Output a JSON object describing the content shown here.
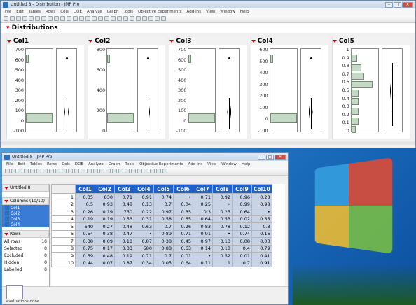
{
  "win1": {
    "title": "Untitled 8 - Distribution - JMP Pro",
    "menu": [
      "File",
      "Edit",
      "Tables",
      "Rows",
      "Cols",
      "DOE",
      "Analyze",
      "Graph",
      "Tools",
      "Objective Experiments",
      "Add-Ins",
      "View",
      "Window",
      "Help"
    ],
    "section_title": "Distributions",
    "panels": [
      {
        "name": "Col1",
        "ticks": [
          "700",
          "600",
          "500",
          "400",
          "300",
          "200",
          "100",
          "0",
          "-100"
        ],
        "bar_frac": 0.12,
        "outlier": true
      },
      {
        "name": "Col2",
        "ticks": [
          "800",
          "600",
          "400",
          "200",
          "0"
        ],
        "bar_frac": 0.1,
        "outlier": true
      },
      {
        "name": "Col3",
        "ticks": [
          "700",
          "600",
          "500",
          "400",
          "300",
          "200",
          "100",
          "0",
          "-100"
        ],
        "bar_frac": 0.12,
        "outlier": true
      },
      {
        "name": "Col4",
        "ticks": [
          "600",
          "500",
          "400",
          "300",
          "200",
          "100",
          "0",
          "-100"
        ],
        "bar_frac": 0.12,
        "outlier": true
      },
      {
        "name": "Col5",
        "ticks": [
          "1",
          "0.9",
          "0.8",
          "0.7",
          "0.6",
          "0.5",
          "0.4",
          "0.3",
          "0.2",
          "0.1",
          "0"
        ],
        "bar_frac": 0,
        "outlier": false
      }
    ]
  },
  "win2": {
    "title": "Untitled 8 - JMP Pro",
    "menu": [
      "File",
      "Edit",
      "Tables",
      "Rows",
      "Cols",
      "DOE",
      "Analyze",
      "Graph",
      "Tools",
      "Objective Experiments",
      "Add-Ins",
      "View",
      "Window",
      "Help"
    ],
    "table_name": "Untitled 8",
    "columns_header": "Columns (10/10)",
    "column_list": [
      "Col1",
      "Col2",
      "Col3",
      "Col4"
    ],
    "rows_header": "Rows",
    "row_summary": [
      {
        "label": "All rows",
        "value": "10"
      },
      {
        "label": "Selected",
        "value": "0"
      },
      {
        "label": "Excluded",
        "value": "0"
      },
      {
        "label": "Hidden",
        "value": "0"
      },
      {
        "label": "Labelled",
        "value": "0"
      }
    ],
    "col_headers": [
      "Col1",
      "Col2",
      "Col3",
      "Col4",
      "Col5",
      "Col6",
      "Col7",
      "Col8",
      "Col9",
      "Col10"
    ],
    "rows": [
      [
        "1",
        "0.35",
        "830",
        "0.71",
        "0.91",
        "0.74",
        "•",
        "0.71",
        "0.92",
        "0.96",
        "0.28"
      ],
      [
        "2",
        "0.5",
        "0.93",
        "0.48",
        "0.13",
        "0.7",
        "0.04",
        "0.25",
        "•",
        "0.99",
        "0.98"
      ],
      [
        "3",
        "0.26",
        "0.19",
        "750",
        "0.22",
        "0.97",
        "0.35",
        "0.3",
        "0.25",
        "0.64",
        "•"
      ],
      [
        "4",
        "0.19",
        "0.19",
        "0.53",
        "0.31",
        "0.58",
        "0.65",
        "0.64",
        "0.53",
        "0.02",
        "0.35"
      ],
      [
        "5",
        "640",
        "0.27",
        "0.48",
        "0.63",
        "0.7",
        "0.26",
        "0.83",
        "0.78",
        "0.12",
        "0.3"
      ],
      [
        "6",
        "0.54",
        "0.38",
        "0.47",
        "•",
        "0.89",
        "0.71",
        "0.91",
        "•",
        "0.74",
        "0.16"
      ],
      [
        "7",
        "0.38",
        "0.09",
        "0.18",
        "0.87",
        "0.38",
        "0.45",
        "0.97",
        "0.13",
        "0.08",
        "0.03"
      ],
      [
        "8",
        "0.75",
        "0.17",
        "0.33",
        "580",
        "0.88",
        "0.63",
        "0.14",
        "0.18",
        "0.4",
        "0.79"
      ],
      [
        "9",
        "0.59",
        "0.48",
        "0.19",
        "0.71",
        "0.7",
        "0.01",
        "•",
        "0.52",
        "0.01",
        "0.41"
      ],
      [
        "10",
        "0.44",
        "0.07",
        "0.87",
        "0.34",
        "0.05",
        "0.64",
        "0.11",
        "1",
        "0.7",
        "0.91"
      ]
    ],
    "status": "evaluations done"
  }
}
